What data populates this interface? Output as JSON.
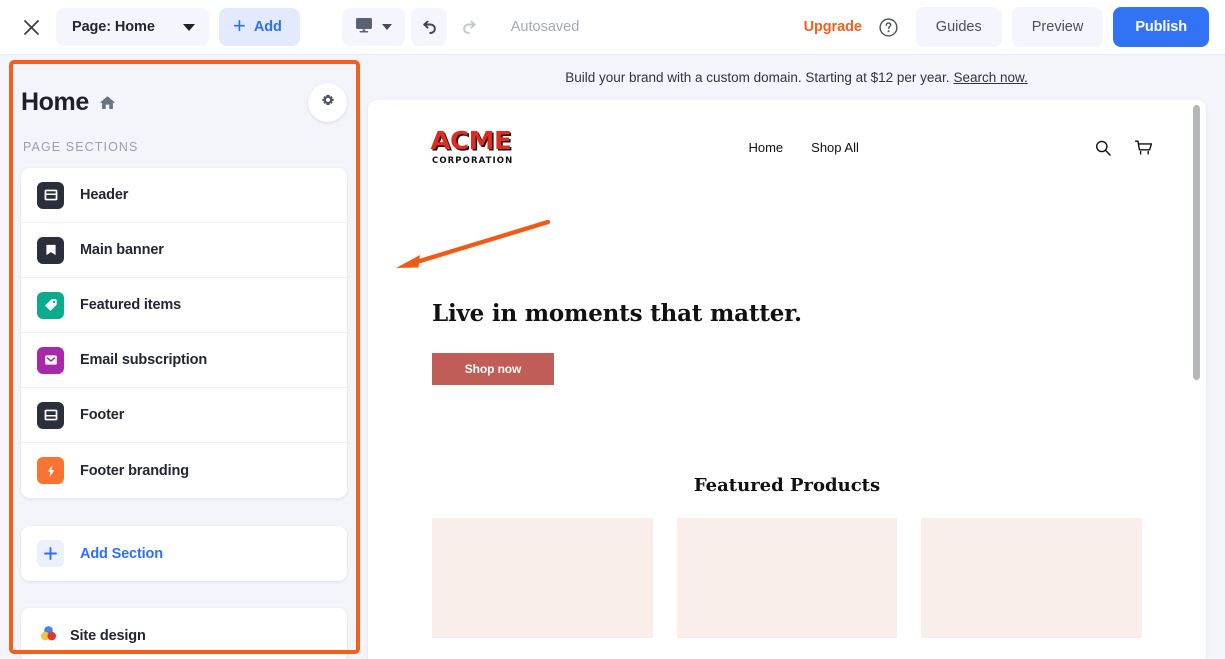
{
  "toolbar": {
    "close_icon": "close-icon",
    "page_selector": {
      "label": "Page: Home",
      "caret": "chevron-down-icon"
    },
    "add_button": {
      "plus": "+",
      "label": "Add"
    },
    "device_selector": {
      "icon": "desktop-monitor-icon",
      "caret": "chevron-down-icon"
    },
    "undo": "undo-icon",
    "redo": "redo-icon",
    "autosaved": "Autosaved",
    "upgrade": "Upgrade",
    "help": "help-circle-icon",
    "guides": "Guides",
    "preview": "Preview",
    "publish": "Publish",
    "accent_blue": "#3273f5",
    "upgrade_orange": "#f0601e"
  },
  "sidebar": {
    "title": "Home",
    "home_icon": "home-icon",
    "settings_icon": "gear-icon",
    "subheader": "PAGE SECTIONS",
    "highlight_color": "#f4601c",
    "sections": [
      {
        "label": "Header",
        "icon": "header-layout-icon",
        "color": "#2b2f3b"
      },
      {
        "label": "Main banner",
        "icon": "bookmark-banner-icon",
        "color": "#2b2f3b"
      },
      {
        "label": "Featured items",
        "icon": "price-tag-icon",
        "color": "#0bab8d"
      },
      {
        "label": "Email subscription",
        "icon": "envelope-icon",
        "color": "#a927a9"
      },
      {
        "label": "Footer",
        "icon": "footer-layout-icon",
        "color": "#2b2f3b"
      },
      {
        "label": "Footer branding",
        "icon": "lightning-bolt-icon",
        "color": "#f97432"
      }
    ],
    "add_section": {
      "label": "Add Section",
      "icon": "plus-icon",
      "color": "#2f6ff5"
    },
    "site_design": {
      "label": "Site design",
      "icon": "color-circles-icon"
    }
  },
  "preview": {
    "promo": {
      "text": "Build your brand with a custom domain. Starting at $12 per year.",
      "link": "Search now."
    },
    "site": {
      "logo": {
        "word": "ACME",
        "subtitle": "CORPORATION",
        "color": "#e02b20"
      },
      "nav": [
        {
          "label": "Home"
        },
        {
          "label": "Shop All"
        }
      ],
      "icons": [
        {
          "name": "search-icon"
        },
        {
          "name": "shopping-cart-icon"
        }
      ],
      "hero": {
        "headline": "Live in moments that matter.",
        "cta_label": "Shop now",
        "cta_color": "#c05d56"
      },
      "featured": {
        "title": "Featured Products",
        "cards": [
          {
            "placeholder": ""
          },
          {
            "placeholder": ""
          },
          {
            "placeholder": ""
          }
        ],
        "card_color": "#faeeeb"
      }
    },
    "scrollbar": {
      "name": "vertical-scrollbar"
    }
  },
  "annotation": {
    "arrow_color": "#f4601c",
    "name": "pointer-arrow"
  }
}
